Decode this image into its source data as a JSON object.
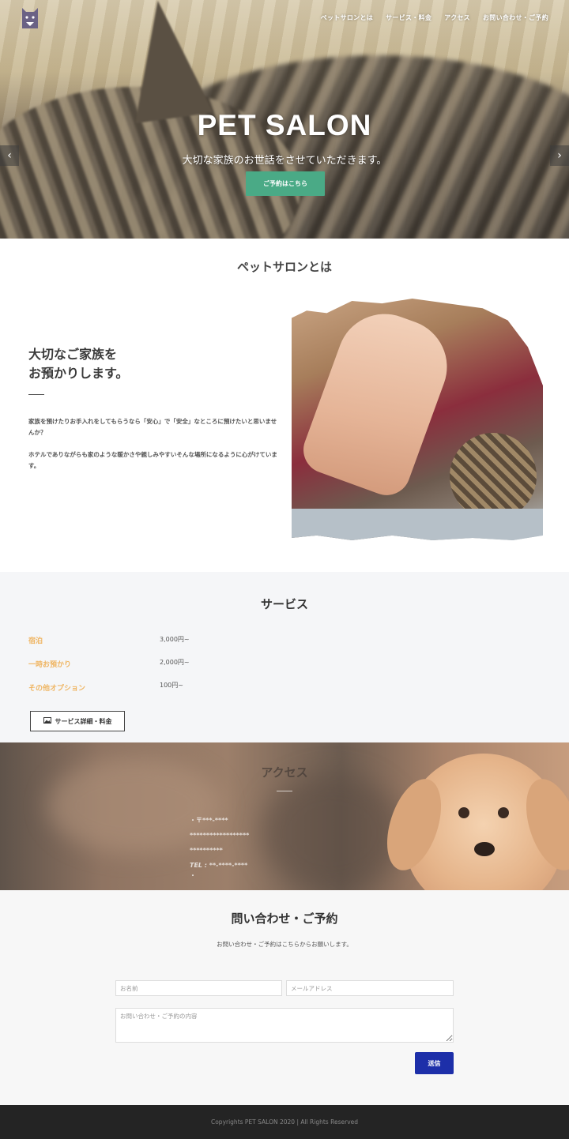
{
  "header": {
    "logo_icon": "cat-icon",
    "nav": [
      {
        "label": "ペットサロンとは"
      },
      {
        "label": "サービス・料金"
      },
      {
        "label": "アクセス"
      },
      {
        "label": "お問い合わせ・ご予約"
      }
    ]
  },
  "hero": {
    "title": "PET SALON",
    "subtitle": "大切な家族のお世話をさせていただきます。",
    "button_label": "ご予約はこちら",
    "button_color": "#4aaa86",
    "prev_icon": "chevron-left-icon",
    "next_icon": "chevron-right-icon"
  },
  "about": {
    "section_title": "ペットサロンとは",
    "heading_line1": "大切なご家族を",
    "heading_line2": "お預かりします。",
    "paragraph1": "家族を預けたりお手入れをしてもらうなら「安心」で「安全」なところに預けたいと思いませんか？",
    "paragraph2": "ホテルでありながらも家のような暖かさや親しみやすいそんな場所になるように心がけています。"
  },
  "service": {
    "section_title": "サービス",
    "accent_color": "#efb562",
    "items": [
      {
        "name": "宿泊",
        "price": "3,000円~"
      },
      {
        "name": "一時お預かり",
        "price": "2,000円~"
      },
      {
        "name": "その他オプション",
        "price": "100円~"
      }
    ],
    "detail_button_label": "サービス詳細・料金",
    "detail_button_icon": "image-icon"
  },
  "access": {
    "section_title": "アクセス",
    "lines": [
      "・〒***-****",
      "******************",
      "**********",
      "TEL : **-****-****",
      "・"
    ]
  },
  "contact": {
    "section_title": "問い合わせ・ご予約",
    "subtitle": "お問い合わせ・ご予約はこちらからお願いします。",
    "name_placeholder": "お名前",
    "email_placeholder": "メールアドレス",
    "message_placeholder": "お問い合わせ・ご予約の内容",
    "submit_label": "送信",
    "submit_color": "#1d2fa9"
  },
  "footer": {
    "copyright": "Copyrights PET SALON 2020 | All Rights Reserved"
  }
}
